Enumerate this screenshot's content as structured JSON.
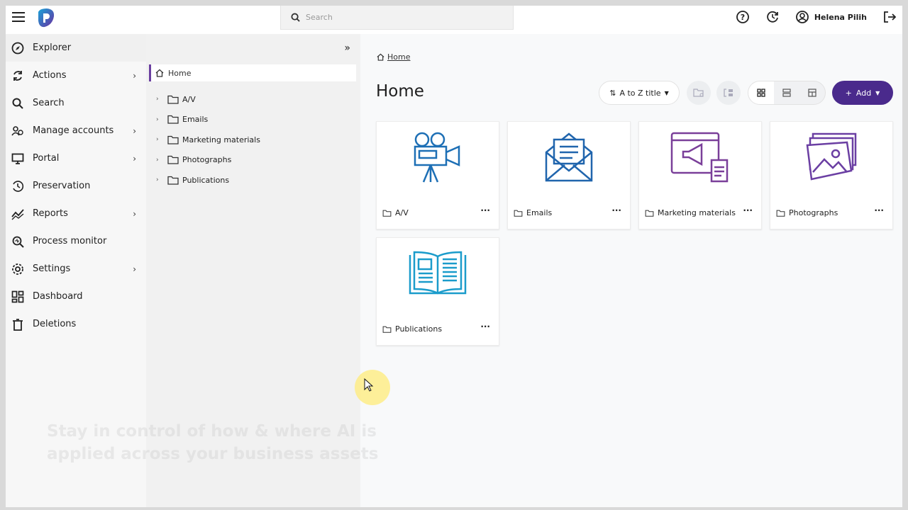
{
  "topbar": {
    "search_placeholder": "Search",
    "user_name": "Helena Pilih"
  },
  "sidebar": {
    "items": [
      {
        "label": "Explorer",
        "icon": "compass-icon",
        "chevron": false
      },
      {
        "label": "Actions",
        "icon": "refresh-icon",
        "chevron": true
      },
      {
        "label": "Search",
        "icon": "search-icon",
        "chevron": false
      },
      {
        "label": "Manage accounts",
        "icon": "accounts-icon",
        "chevron": true
      },
      {
        "label": "Portal",
        "icon": "monitor-icon",
        "chevron": true
      },
      {
        "label": "Preservation",
        "icon": "preservation-icon",
        "chevron": false
      },
      {
        "label": "Reports",
        "icon": "chart-icon",
        "chevron": true
      },
      {
        "label": "Process monitor",
        "icon": "process-icon",
        "chevron": false
      },
      {
        "label": "Settings",
        "icon": "gear-icon",
        "chevron": true
      },
      {
        "label": "Dashboard",
        "icon": "dashboard-icon",
        "chevron": false
      },
      {
        "label": "Deletions",
        "icon": "trash-icon",
        "chevron": false
      }
    ]
  },
  "tree": {
    "home": "Home",
    "folders": [
      "A/V",
      "Emails",
      "Marketing materials",
      "Photographs",
      "Publications"
    ]
  },
  "main": {
    "breadcrumb": "Home",
    "title": "Home",
    "sort_label": "A to Z title",
    "add_label": "Add",
    "cards": [
      {
        "label": "A/V",
        "color": "#1d6fb5"
      },
      {
        "label": "Emails",
        "color": "#2065ad"
      },
      {
        "label": "Marketing materials",
        "color": "#7a3f99"
      },
      {
        "label": "Photographs",
        "color": "#6b3fa3"
      },
      {
        "label": "Publications",
        "color": "#1b9ccb"
      }
    ]
  },
  "overlay_text": "Stay in control of how & where AI is applied across your business assets"
}
